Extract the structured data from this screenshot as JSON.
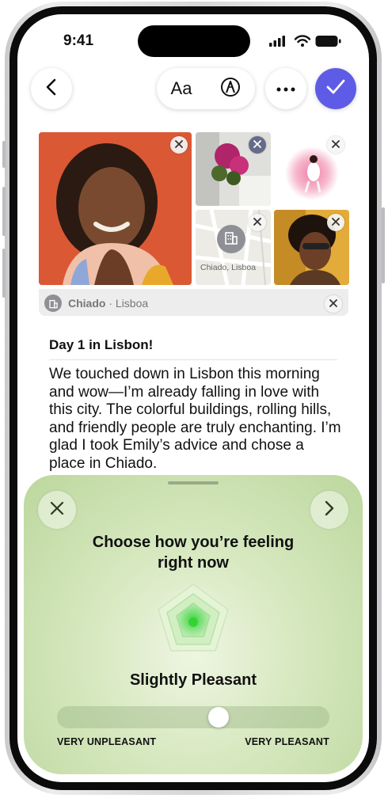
{
  "status_bar": {
    "time": "9:41"
  },
  "toolbar": {
    "back_icon": "chevron-left-icon",
    "format_label": "Aa",
    "markup_icon": "pencil-tip-icon",
    "more_icon": "ellipsis-icon",
    "done_icon": "checkmark-icon",
    "accent_color": "#5e5ce6"
  },
  "attachments": {
    "map_caption": "Chiado, Lisboa",
    "location": {
      "name": "Chiado",
      "separator": "·",
      "city": "Lisboa"
    }
  },
  "entry": {
    "title": "Day 1 in Lisbon!",
    "body": "We touched down in Lisbon this morning and wow—I’m already falling in love with this city. The colorful buildings, rolling hills, and friendly people are truly enchanting. I’m glad I took Emily’s advice and chose a place in Chiado."
  },
  "mood_sheet": {
    "close_icon": "close-icon",
    "next_icon": "chevron-right-icon",
    "question": "Choose how you’re feeling right now",
    "selected_mood": "Slightly Pleasant",
    "slider_value": 0.6,
    "scale_min_label": "VERY UNPLEASANT",
    "scale_max_label": "VERY PLEASANT",
    "sheet_color": "#c8dfa8",
    "mood_color": "#6fd36b"
  }
}
